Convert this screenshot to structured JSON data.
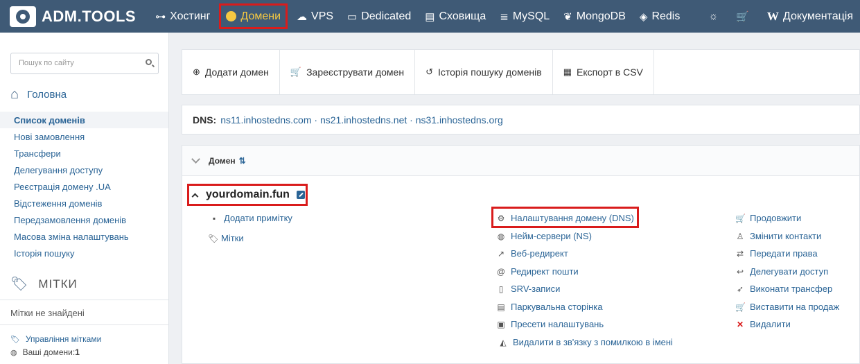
{
  "nav": {
    "logo": "ADM.TOOLS",
    "items": [
      {
        "label": "Хостинг",
        "icon": "sitemap-icon"
      },
      {
        "label": "Домени",
        "icon": "globe-icon"
      },
      {
        "label": "VPS",
        "icon": "cloud-icon"
      },
      {
        "label": "Dedicated",
        "icon": "server-icon"
      },
      {
        "label": "Сховища",
        "icon": "storage-icon"
      },
      {
        "label": "MySQL",
        "icon": "database-icon"
      },
      {
        "label": "MongoDB",
        "icon": "leaf-icon"
      },
      {
        "label": "Redis",
        "icon": "cube-icon"
      }
    ],
    "docs": "Документація"
  },
  "sidebar": {
    "search_placeholder": "Пошук по сайту",
    "home": "Головна",
    "links": [
      "Список доменів",
      "Нові замовлення",
      "Трансфери",
      "Делегування доступу",
      "Реєстрація домену .UA",
      "Відстеження доменів",
      "Передзамовлення доменів",
      "Масова зміна налаштувань",
      "Історія пошуку"
    ],
    "tags_title": "МІТКИ",
    "no_tags": "Мітки не знайдені",
    "manage_tags": "Управління мітками",
    "your_domains_label": "Ваші домени:",
    "your_domains_count": "1"
  },
  "toolbar": {
    "add": "Додати домен",
    "register": "Зареєструвати домен",
    "history": "Історія пошуку доменів",
    "export": "Експорт в CSV"
  },
  "dns": {
    "label": "DNS:",
    "servers": "ns11.inhostedns.com · ns21.inhostedns.net · ns31.inhostedns.org"
  },
  "domains": {
    "column": "Домен",
    "name": "yourdomain.fun",
    "add_note": "Додати примітку",
    "tags": "Мітки",
    "actions_mid": [
      "Налаштування домену (DNS)",
      "Нейм-сервери (NS)",
      "Веб-редирект",
      "Редирект пошти",
      "SRV-записи",
      "Паркувальна сторінка",
      "Пресети налаштувань",
      "Видалити в зв'язку з помилкою в імені"
    ],
    "actions_right": [
      "Продовжити",
      "Змінити контакти",
      "Передати права",
      "Делегувати доступ",
      "Виконати трансфер",
      "Виставити на продаж",
      "Видалити"
    ]
  }
}
